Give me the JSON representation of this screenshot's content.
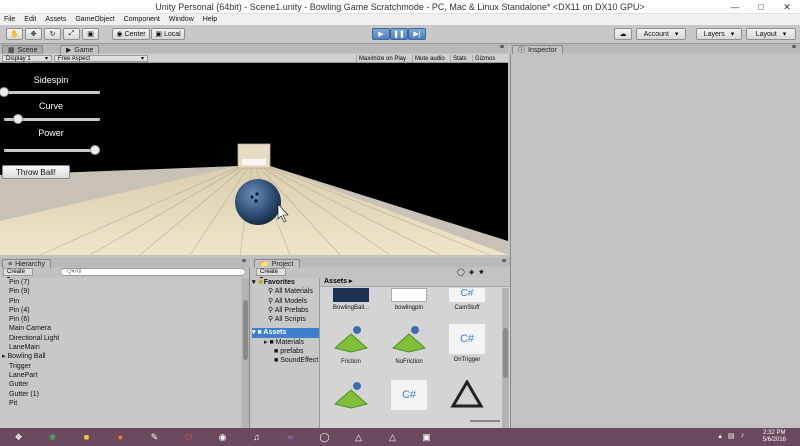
{
  "window": {
    "title": "Unity Personal (64bit) - Scene1.unity - Bowling Game Scratchmode - PC, Mac & Linux Standalone* <DX11 on DX10 GPU>"
  },
  "menu": [
    "File",
    "Edit",
    "Assets",
    "GameObject",
    "Component",
    "Window",
    "Help"
  ],
  "toolbar": {
    "center_label": "Center",
    "local_label": "Local",
    "account_label": "Account",
    "layers_label": "Layers",
    "layout_label": "Layout"
  },
  "tabs": {
    "scene": "Scene",
    "game": "Game",
    "inspector": "Inspector",
    "hierarchy": "Hierarchy",
    "project": "Project"
  },
  "game_bar": {
    "display": "Display 1",
    "aspect": "Free Aspect",
    "maximize": "Maximize on Play",
    "mute": "Mute audio",
    "stats": "Stats",
    "gizmos": "Gizmos"
  },
  "game_ui": {
    "sidespin": {
      "label": "Sidespin",
      "value": 0.0
    },
    "curve": {
      "label": "Curve",
      "value": 0.15
    },
    "power": {
      "label": "Power",
      "value": 0.95
    },
    "throw_label": "Throw Ball!"
  },
  "hierarchy": {
    "create_label": "Create",
    "search_placeholder": "Q▾All",
    "items": [
      "Pin (7)",
      "Pin (9)",
      "Pin",
      "Pin (4)",
      "Pin (6)",
      "Main Camera",
      "Directional Light",
      "LaneMain",
      "Bowling Ball",
      "Trigger",
      "LanePart",
      "Gutter",
      "Gutter (1)",
      "Pit"
    ]
  },
  "project": {
    "create_label": "Create",
    "favorites": {
      "header": "Favorites",
      "items": [
        "All Materials",
        "All Models",
        "All Prefabs",
        "All Scripts"
      ]
    },
    "assets_tree": {
      "header": "Assets",
      "items": [
        "Materials",
        "prefabs",
        "SoundEffect"
      ]
    },
    "assets_header": "Assets ▸",
    "assets": [
      "BowlingBall...",
      "bowlingpin",
      "CamStuff",
      "Friction",
      "NoFriction",
      "OnTrigger"
    ]
  },
  "clock": {
    "time": "2:32 PM",
    "date": "5/6/2016"
  },
  "colors": {
    "accent": "#3e7fd0",
    "taskbar": "#6b4a5e",
    "game_bg": "#000000"
  }
}
